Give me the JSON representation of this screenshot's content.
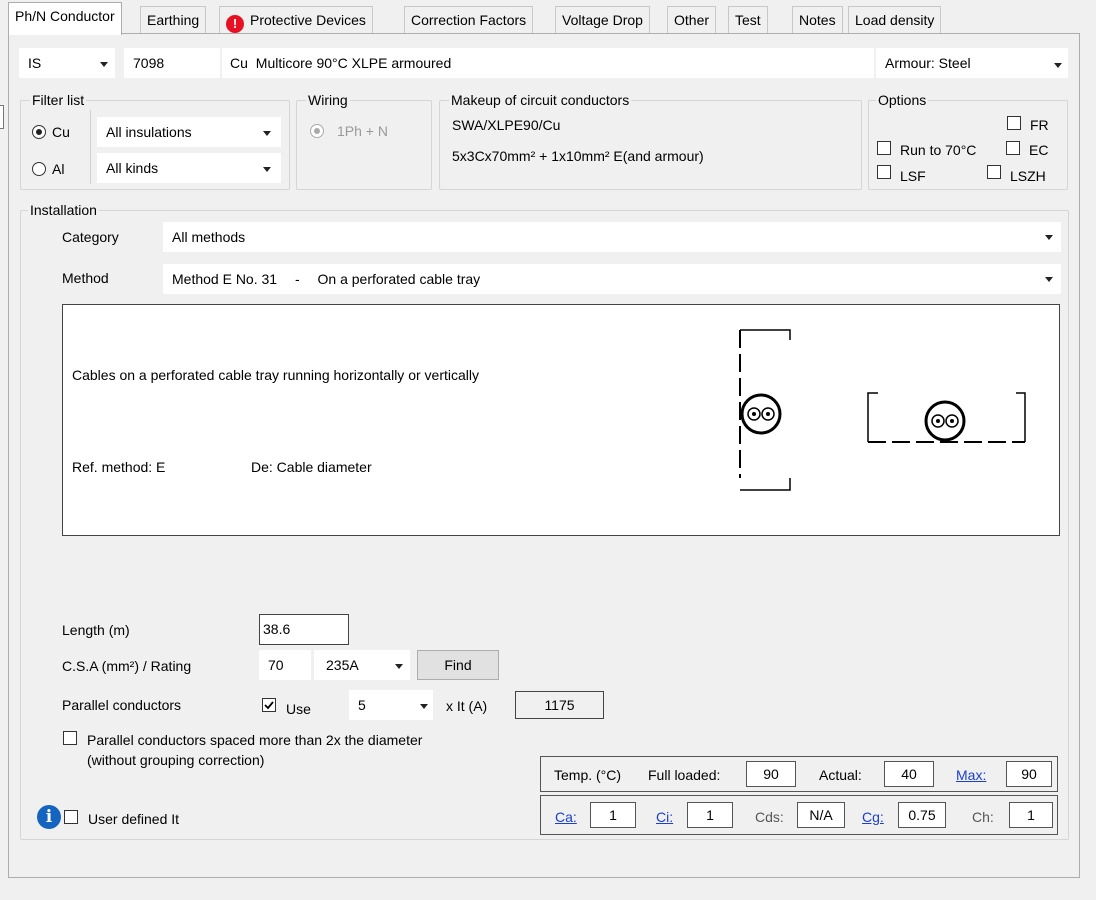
{
  "tabs": [
    {
      "label": "Ph/N Conductor"
    },
    {
      "label": "Earthing"
    },
    {
      "label": "Protective Devices"
    },
    {
      "label": "Correction Factors"
    },
    {
      "label": "Voltage Drop"
    },
    {
      "label": "Other"
    },
    {
      "label": "Test"
    },
    {
      "label": "Notes"
    },
    {
      "label": "Load density"
    }
  ],
  "cable": {
    "standard": "IS",
    "code": "7098",
    "material": "Cu",
    "description": "Multicore 90°C XLPE armoured",
    "armour": "Armour: Steel"
  },
  "filter": {
    "label": "Filter list",
    "cu": "Cu",
    "al": "Al",
    "insulation": "All insulations",
    "kind": "All kinds"
  },
  "wiring": {
    "label": "Wiring",
    "option": "1Ph + N"
  },
  "makeup": {
    "label": "Makeup of circuit conductors",
    "line1": "SWA/XLPE90/Cu",
    "line2": "5x3Cx70mm² + 1x10mm² E(and armour)"
  },
  "options": {
    "label": "Options",
    "fr": "FR",
    "run70": "Run to 70°C",
    "ec": "EC",
    "lsf": "LSF",
    "lszh": "LSZH"
  },
  "installation": {
    "label": "Installation",
    "category_label": "Category",
    "category_value": "All methods",
    "method_label": "Method",
    "method_value": "Method E No. 31",
    "method_sep": "-",
    "method_desc": "On a perforated cable tray",
    "description": "Cables on a perforated cable tray running horizontally or vertically",
    "ref_method": "Ref. method: E",
    "de": "De: Cable diameter"
  },
  "length": {
    "label": "Length (m)",
    "value": "38.6"
  },
  "csa": {
    "label": "C.S.A (mm²) / Rating",
    "value": "70",
    "rating": "235A",
    "find": "Find"
  },
  "parallel": {
    "label": "Parallel conductors",
    "use": "Use",
    "count": "5",
    "it_label": "x It (A)",
    "it_value": "1175",
    "spaced_line1": "Parallel conductors spaced more than 2x the diameter",
    "spaced_line2": "(without grouping correction)"
  },
  "user_defined": "User defined It",
  "temp": {
    "label": "Temp. (°C)",
    "full_label": "Full loaded:",
    "full_value": "90",
    "actual_label": "Actual:",
    "actual_value": "40",
    "max_label": "Max:",
    "max_value": "90"
  },
  "factors": {
    "ca_label": "Ca:",
    "ca": "1",
    "ci_label": "Ci:",
    "ci": "1",
    "cds_label": "Cds:",
    "cds": "N/A",
    "cg_label": "Cg:",
    "cg": "0.75",
    "ch_label": "Ch:",
    "ch": "1"
  },
  "colors": {
    "link": "#1a3fd1",
    "warning": "#e81123",
    "info": "#1565c0"
  }
}
